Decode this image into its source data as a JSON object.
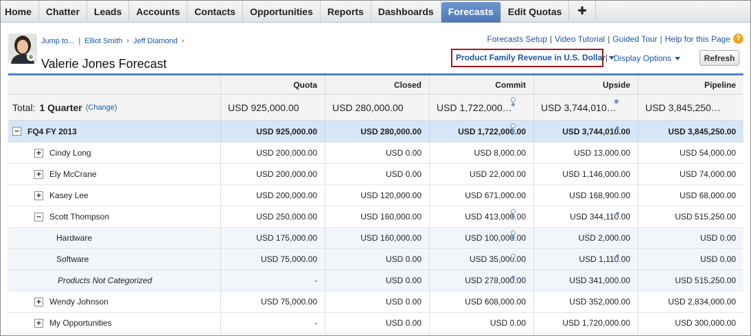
{
  "nav": {
    "tabs": [
      "Home",
      "Chatter",
      "Leads",
      "Accounts",
      "Contacts",
      "Opportunities",
      "Reports",
      "Dashboards",
      "Forecasts",
      "Edit Quotas"
    ],
    "active": "Forecasts",
    "add_label": "✚"
  },
  "breadcrumb": {
    "jump": "Jump to...",
    "crumb1": "Elliot Smith",
    "crumb2": "Jeff Diamond",
    "sep": "›"
  },
  "page_title": "Valerie Jones Forecast",
  "top_links": {
    "setup": "Forecasts Setup",
    "video": "Video Tutorial",
    "tour": "Guided Tour",
    "help": "Help for this Page",
    "help_icon": "?"
  },
  "forecast_type": "Product Family Revenue in U.S. Dollar",
  "display_options": "Display Options",
  "refresh_label": "Refresh",
  "columns": [
    "Quota",
    "Closed",
    "Commit",
    "Upside",
    "Pipeline"
  ],
  "total": {
    "label": "Total:",
    "period": "1 Quarter",
    "change": "(Change)",
    "values": [
      "USD 925,000.00",
      "USD 280,000.00",
      "USD 1,722,000…",
      "USD 3,744,010…",
      "USD 3,845,250…"
    ]
  },
  "period_row": {
    "label": "FQ4 FY 2013",
    "values": [
      "USD 925,000.00",
      "USD 280,000.00",
      "USD 1,722,000.00",
      "USD 3,744,010.00",
      "USD 3,845,250.00"
    ]
  },
  "rows": [
    {
      "name": "Cindy Long",
      "values": [
        "USD 200,000.00",
        "USD 0.00",
        "USD 8,000.00",
        "USD 13,000.00",
        "USD 54,000.00"
      ]
    },
    {
      "name": "Ely McCrane",
      "values": [
        "USD 200,000.00",
        "USD 0.00",
        "USD 22,000.00",
        "USD 1,146,000.00",
        "USD 74,000.00"
      ]
    },
    {
      "name": "Kasey Lee",
      "values": [
        "USD 200,000.00",
        "USD 120,000.00",
        "USD 671,000.00",
        "USD 168,900.00",
        "USD 68,000.00"
      ]
    },
    {
      "name": "Scott Thompson",
      "values": [
        "USD 250,000.00",
        "USD 160,000.00",
        "USD 413,000.00",
        "USD 344,110.00",
        "USD 515,250.00"
      ]
    },
    {
      "name": "Hardware",
      "values": [
        "USD 175,000.00",
        "USD 160,000.00",
        "USD 100,000.00",
        "USD 2,000.00",
        "USD 0.00"
      ]
    },
    {
      "name": "Software",
      "values": [
        "USD 75,000.00",
        "USD 0.00",
        "USD 35,000.00",
        "USD 1,110.00",
        "USD 0.00"
      ]
    },
    {
      "name": "Products Not Categorized",
      "values": [
        "-",
        "USD 0.00",
        "USD 278,000.00",
        "USD 341,000.00",
        "USD 515,250.00"
      ]
    },
    {
      "name": "Wendy Johnson",
      "values": [
        "USD 75,000.00",
        "USD 0.00",
        "USD 608,000.00",
        "USD 352,000.00",
        "USD 2,834,000.00"
      ]
    },
    {
      "name": "My Opportunities",
      "values": [
        "-",
        "USD 0.00",
        "USD 0.00",
        "USD 1,720,000.00",
        "USD 300,000.00"
      ]
    }
  ],
  "icons": {
    "expand": "+",
    "collapse": "−"
  }
}
